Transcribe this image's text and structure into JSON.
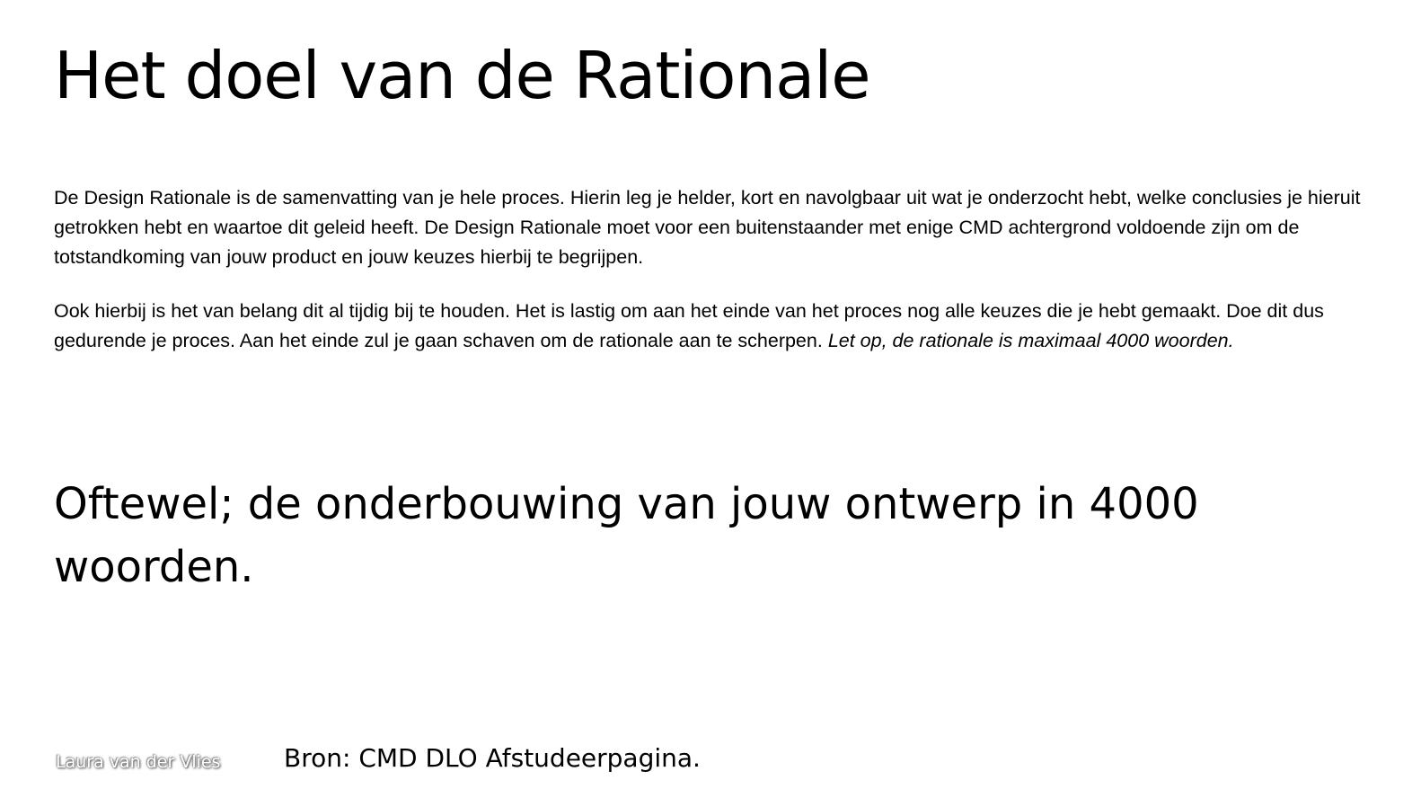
{
  "slide": {
    "title": "Het doel van de Rationale",
    "paragraph_1": "De Design Rationale is de samenvatting van je hele proces. Hierin leg je helder, kort en navolgbaar uit wat je onderzocht hebt, welke conclusies je hieruit getrokken hebt en waartoe dit geleid heeft. De Design Rationale moet voor een buitenstaander met enige CMD achtergrond voldoende zijn om de totstandkoming van jouw product en jouw keuzes hierbij te begrijpen.",
    "paragraph_2": "Ook hierbij is het van belang dit al tijdig bij te houden. Het is lastig om aan het einde van het proces nog alle keuzes die je hebt gemaakt. Doe dit dus gedurende je proces. Aan het einde zul je gaan schaven om de rationale aan te scherpen.",
    "paragraph_2_italic": "Let op, de rationale is maximaal 4000 woorden.",
    "subtitle": "Oftewel; de onderbouwing van jouw ontwerp in 4000 woorden."
  },
  "footer": {
    "author": "Laura van der Vlies",
    "source": "Bron: CMD DLO Afstudeerpagina."
  }
}
